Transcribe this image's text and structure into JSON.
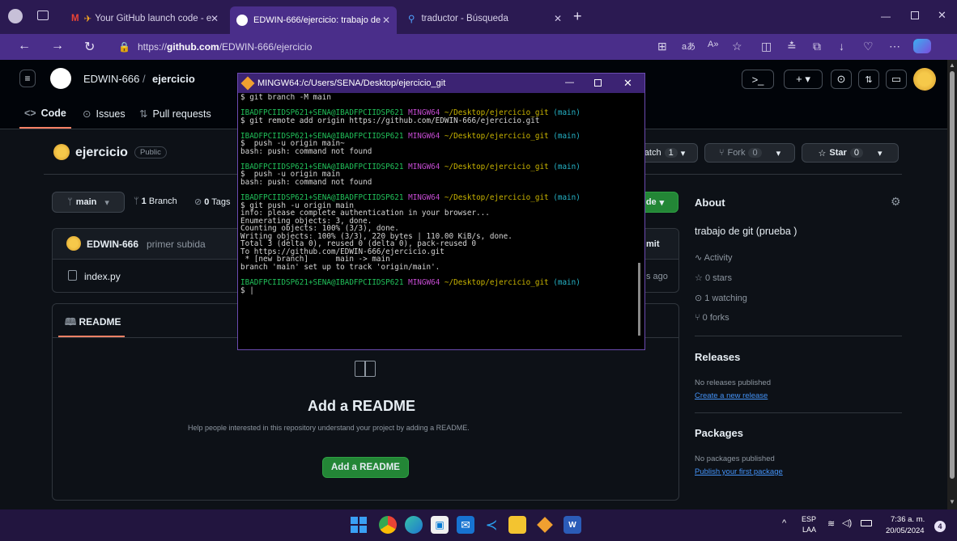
{
  "browser": {
    "tabs": [
      {
        "label": "Your GitHub launch code - e",
        "icon": "gmail-icon"
      },
      {
        "label": "EDWIN-666/ejercicio: trabajo de",
        "icon": "github-icon"
      },
      {
        "label": "traductor - Búsqueda",
        "icon": "search-icon"
      }
    ],
    "url_prefix": "https://",
    "url_domain": "github.com",
    "url_path": "/EDWIN-666/ejercicio"
  },
  "github": {
    "owner": "EDWIN-666",
    "slash": "/",
    "repo": "ejercicio",
    "nav": {
      "code": "Code",
      "issues": "Issues",
      "pulls": "Pull requests"
    },
    "visibility": "Public",
    "watch_label": "atch",
    "watch_count": "1",
    "fork_label": "Fork",
    "fork_count": "0",
    "star_label": "Star",
    "star_count": "0",
    "branch": "main",
    "branch_count_num": "1",
    "branch_count_label": "Branch",
    "tags_num": "0",
    "tags_label": "Tags",
    "code_btn": "de",
    "commit_author": "EDWIN-666",
    "commit_msg": "primer subida",
    "commit_right": "mit",
    "file_name": "index.py",
    "file_age": "s ago",
    "readme_tab": "README",
    "readme_title": "Add a README",
    "readme_help": "Help people interested in this repository understand your project by adding a README.",
    "readme_button": "Add a README",
    "about": {
      "title": "About",
      "description": "trabajo de git (prueba )",
      "activity": "Activity",
      "stars": "0 stars",
      "watching": "1 watching",
      "forks": "0 forks"
    },
    "releases": {
      "title": "Releases",
      "none": "No releases published",
      "link": "Create a new release"
    },
    "packages": {
      "title": "Packages",
      "none": "No packages published",
      "link": "Publish your first package"
    }
  },
  "terminal": {
    "title": "MINGW64:/c/Users/SENA/Desktop/ejercicio_git",
    "prompt_user": "IBADFPCIIDSP621+SENA@IBADFPCIIDSP621",
    "prompt_sys": "MINGW64",
    "prompt_path": "~/Desktop/ejercicio_git",
    "prompt_branch": "(main)",
    "lines": {
      "l0": "$ git branch -M main",
      "l2": "$ git remote add origin https://github.com/EDWIN-666/ejercicio.git",
      "l5": "$  push -u origin main~",
      "l6": "bash: push: command not found",
      "l9": "$  push -u origin main",
      "l10": "bash: push: command not found",
      "l13": "$ git push -u origin main",
      "l14": "info: please complete authentication in your browser...",
      "l15": "Enumerating objects: 3, done.",
      "l16": "Counting objects: 100% (3/3), done.",
      "l17": "Writing objects: 100% (3/3), 220 bytes | 110.00 KiB/s, done.",
      "l18": "Total 3 (delta 0), reused 0 (delta 0), pack-reused 0",
      "l19": "To https://github.com/EDWIN-666/ejercicio.git",
      "l20": " * [new branch]      main -> main",
      "l21": "branch 'main' set up to track 'origin/main'.",
      "l24": "$ |"
    }
  },
  "taskbar": {
    "lang": "ESP",
    "lang_sub": "LAA",
    "time": "7:36 a. m.",
    "date": "20/05/2024",
    "notif": "4"
  },
  "colors": {
    "accent_green": "#238636",
    "link_blue": "#4493f8",
    "browser_purple": "#4a2e8a"
  }
}
